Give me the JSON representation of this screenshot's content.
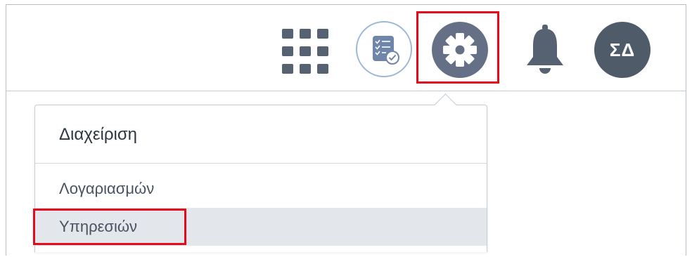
{
  "header": {
    "apps_icon": "apps-grid-icon",
    "tasks_icon": "task-checklist-icon",
    "settings_icon": "gear-icon",
    "notifications_icon": "bell-icon",
    "avatar_initials": "ΣΔ"
  },
  "dropdown": {
    "title": "Διαχείριση",
    "items": [
      {
        "label": "Λογαριασμών"
      },
      {
        "label": "Υπηρεσιών"
      }
    ]
  },
  "colors": {
    "highlight": "#e8091a",
    "icon_dark": "#566171",
    "gear_bg": "#656f86",
    "avatar_bg": "#505b6a",
    "selected_item_bg": "#e3e6ea"
  }
}
